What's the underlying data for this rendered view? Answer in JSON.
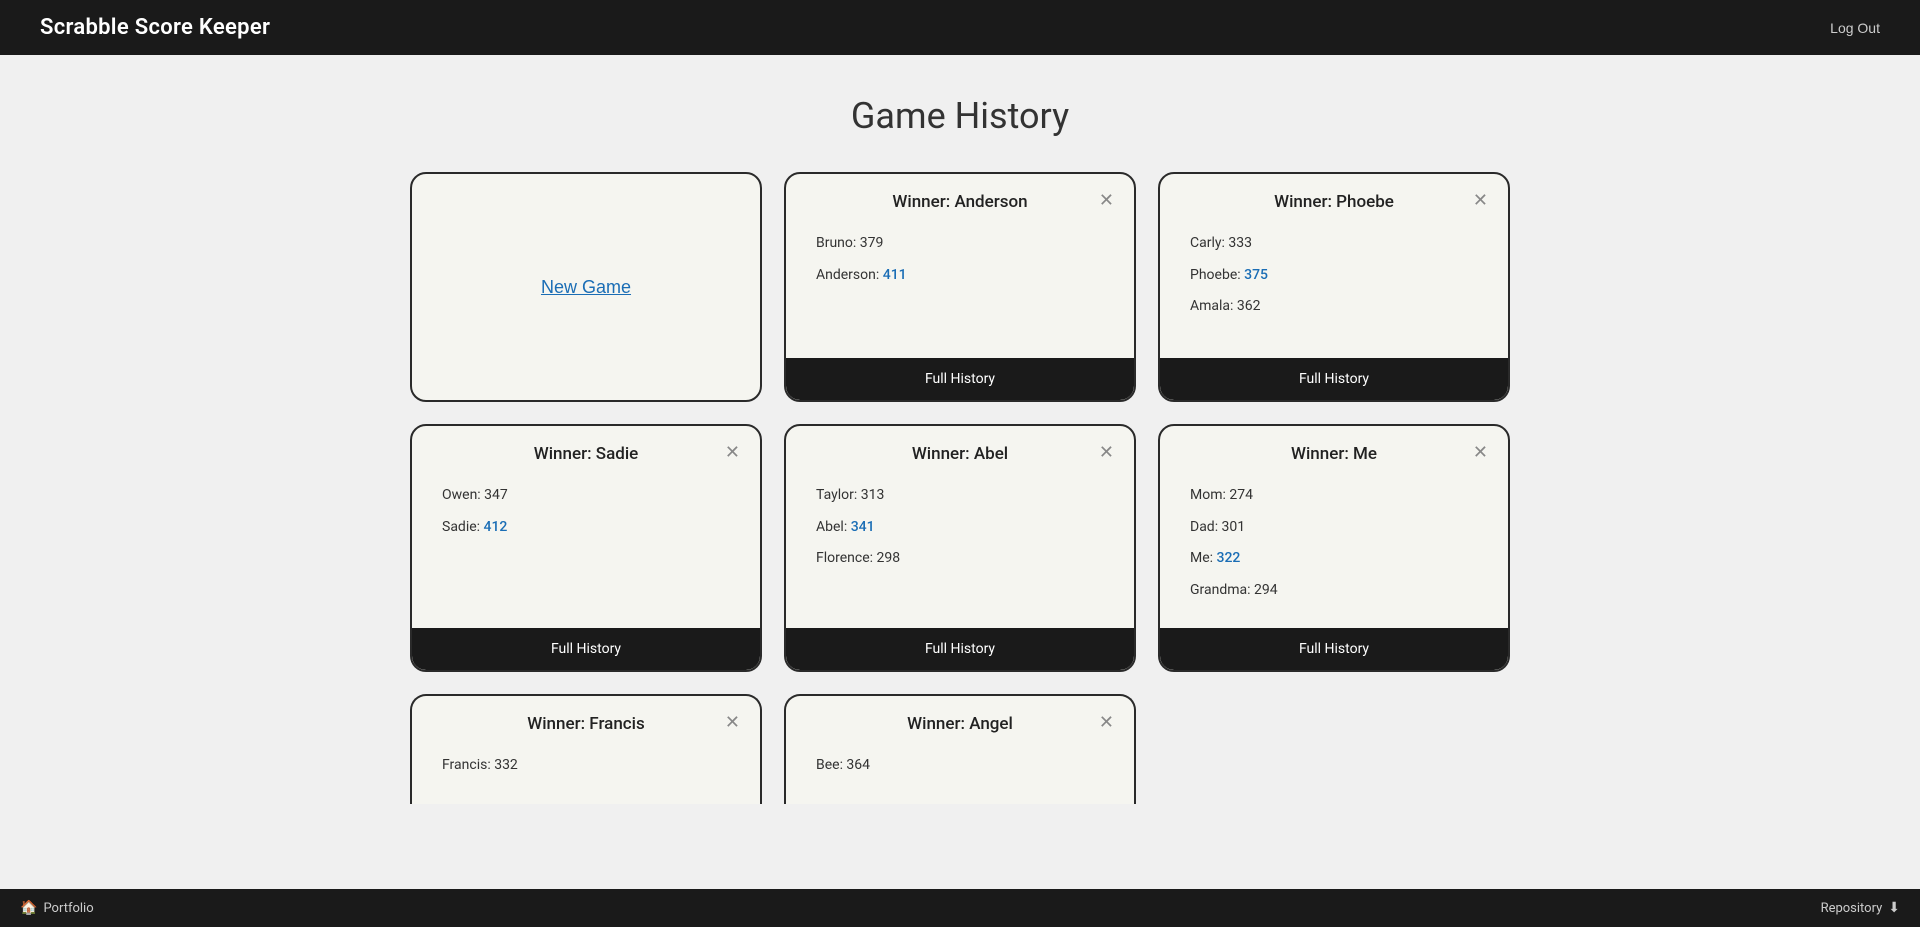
{
  "header": {
    "title": "Scrabble Score Keeper",
    "logout_label": "Log Out"
  },
  "page": {
    "title": "Game History"
  },
  "new_game": {
    "label": "New Game"
  },
  "games": [
    {
      "id": "anderson",
      "winner_label": "Winner: Anderson",
      "players": [
        {
          "name": "Bruno",
          "score": "379",
          "is_winner": false
        },
        {
          "name": "Anderson",
          "score": "411",
          "is_winner": true
        }
      ],
      "footer_label": "Full History"
    },
    {
      "id": "phoebe",
      "winner_label": "Winner: Phoebe",
      "players": [
        {
          "name": "Carly",
          "score": "333",
          "is_winner": false
        },
        {
          "name": "Phoebe",
          "score": "375",
          "is_winner": true
        },
        {
          "name": "Amala",
          "score": "362",
          "is_winner": false
        }
      ],
      "footer_label": "Full History"
    },
    {
      "id": "sadie",
      "winner_label": "Winner: Sadie",
      "players": [
        {
          "name": "Owen",
          "score": "347",
          "is_winner": false
        },
        {
          "name": "Sadie",
          "score": "412",
          "is_winner": true
        }
      ],
      "footer_label": "Full History"
    },
    {
      "id": "abel",
      "winner_label": "Winner: Abel",
      "players": [
        {
          "name": "Taylor",
          "score": "313",
          "is_winner": false
        },
        {
          "name": "Abel",
          "score": "341",
          "is_winner": true
        },
        {
          "name": "Florence",
          "score": "298",
          "is_winner": false
        }
      ],
      "footer_label": "Full History"
    },
    {
      "id": "me",
      "winner_label": "Winner: Me",
      "players": [
        {
          "name": "Mom",
          "score": "274",
          "is_winner": false
        },
        {
          "name": "Dad",
          "score": "301",
          "is_winner": false
        },
        {
          "name": "Me",
          "score": "322",
          "is_winner": true
        },
        {
          "name": "Grandma",
          "score": "294",
          "is_winner": false
        }
      ],
      "footer_label": "Full History"
    }
  ],
  "partial_games": [
    {
      "id": "francis",
      "winner_label": "Winner: Francis",
      "players": [
        {
          "name": "Francis",
          "score": "332",
          "is_winner": true
        }
      ]
    },
    {
      "id": "angel",
      "winner_label": "Winner: Angel",
      "players": [
        {
          "name": "Bee",
          "score": "364",
          "is_winner": false
        }
      ]
    }
  ],
  "footer": {
    "portfolio_label": "Portfolio",
    "repository_label": "Repository",
    "portfolio_icon": "🏠",
    "repository_icon": "◎"
  }
}
